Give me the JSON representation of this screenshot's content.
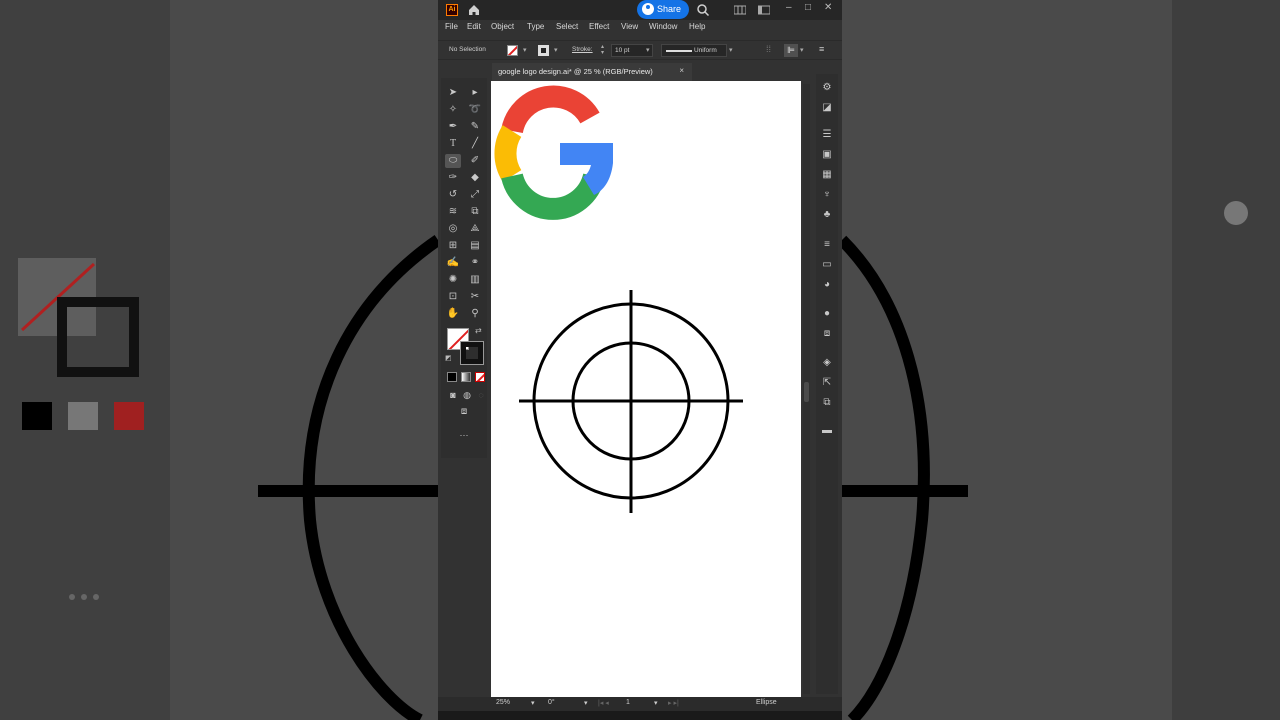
{
  "window": {
    "app_icon_text": "Ai",
    "share_label": "Share"
  },
  "menu": [
    "File",
    "Edit",
    "Object",
    "Type",
    "Select",
    "Effect",
    "View",
    "Window",
    "Help"
  ],
  "control_bar": {
    "selection_label": "No Selection",
    "stroke_label": "Stroke:",
    "stroke_weight": "10 pt",
    "profile": "Uniform"
  },
  "document": {
    "tab_title": "google logo design.ai* @ 25 % (RGB/Preview)",
    "close_glyph": "×"
  },
  "status": {
    "zoom": "25%",
    "rotation": "0°",
    "artboard": "1",
    "tool_name": "Ellipse"
  },
  "toolbar": {
    "more_glyph": "···"
  },
  "colors": {
    "google_red": "#ea4335",
    "google_yellow": "#fbbc05",
    "google_green": "#34a853",
    "google_blue": "#4285f4",
    "share_blue": "#1473e6"
  }
}
